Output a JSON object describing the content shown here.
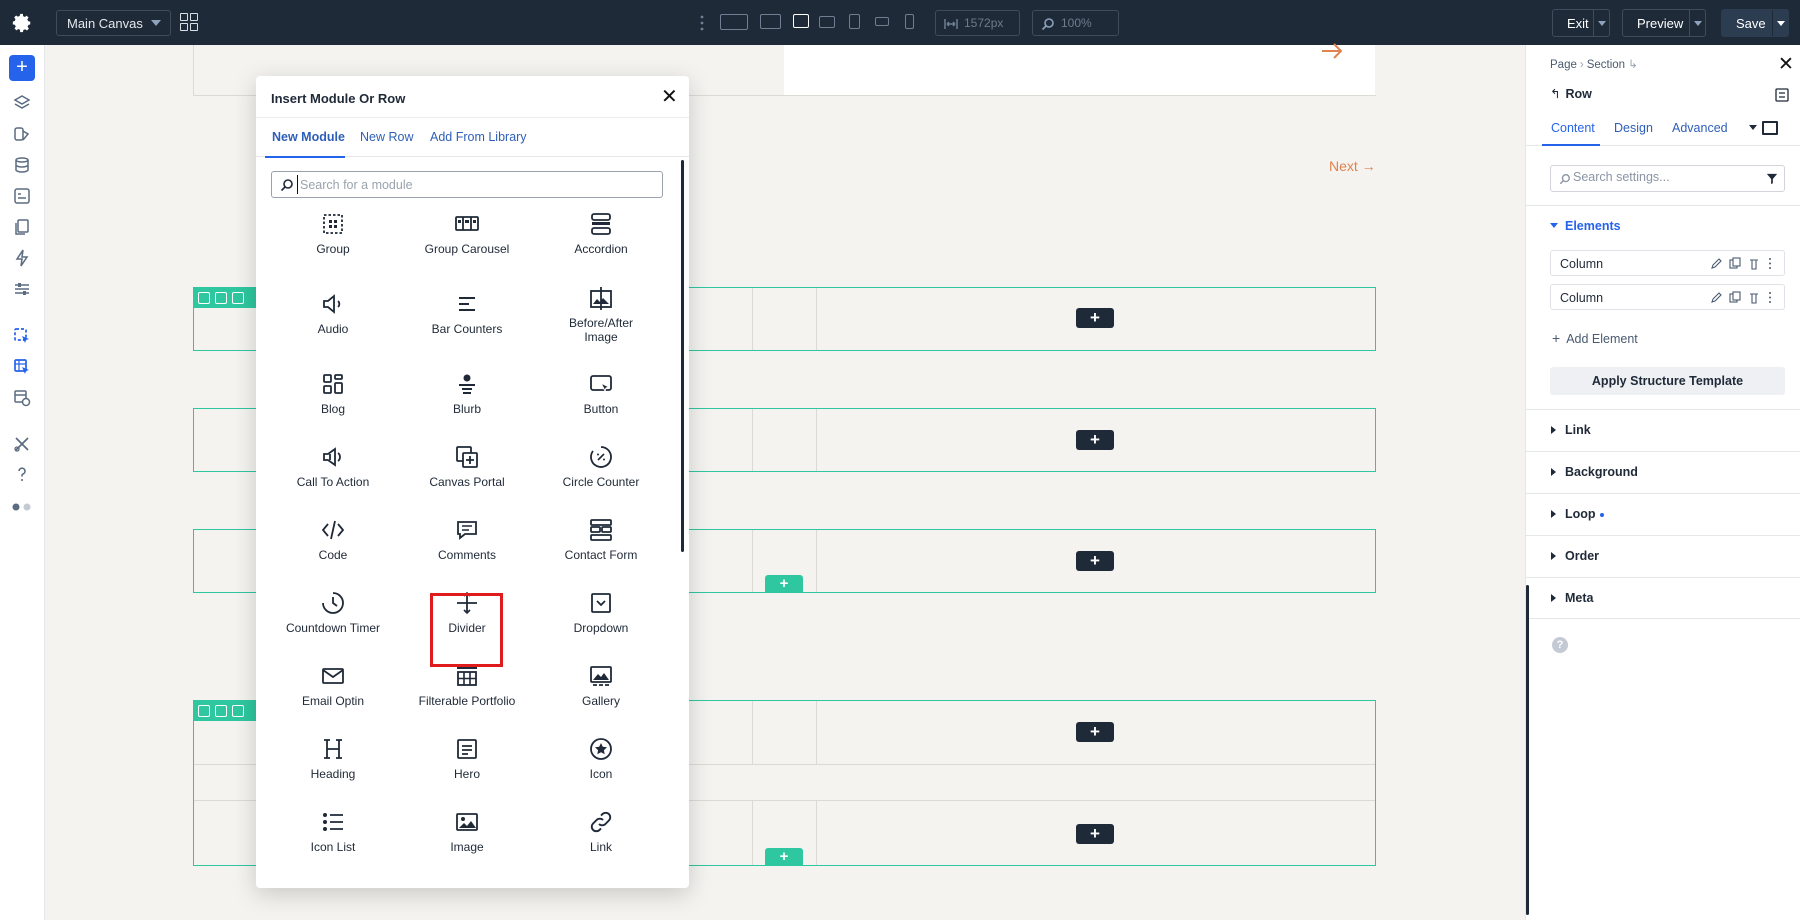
{
  "toolbar": {
    "canvas_select": "Main Canvas",
    "width_value": "1572px",
    "zoom_value": "100%",
    "exit_label": "Exit",
    "preview_label": "Preview",
    "save_label": "Save"
  },
  "canvas": {
    "next_label": "Next →"
  },
  "modal": {
    "title": "Insert Module Or Row",
    "tabs": [
      "New Module",
      "New Row",
      "Add From Library"
    ],
    "search_placeholder": "Search for a module",
    "modules": [
      {
        "label": "Group",
        "icon": "group-icon"
      },
      {
        "label": "Group Carousel",
        "icon": "group-carousel-icon"
      },
      {
        "label": "Accordion",
        "icon": "accordion-icon"
      },
      {
        "label": "Audio",
        "icon": "audio-icon"
      },
      {
        "label": "Bar Counters",
        "icon": "bar-counters-icon"
      },
      {
        "label": "Before/After Image",
        "icon": "before-after-image-icon"
      },
      {
        "label": "Blog",
        "icon": "blog-icon"
      },
      {
        "label": "Blurb",
        "icon": "blurb-icon"
      },
      {
        "label": "Button",
        "icon": "button-icon"
      },
      {
        "label": "Call To Action",
        "icon": "call-to-action-icon"
      },
      {
        "label": "Canvas Portal",
        "icon": "canvas-portal-icon"
      },
      {
        "label": "Circle Counter",
        "icon": "circle-counter-icon"
      },
      {
        "label": "Code",
        "icon": "code-icon"
      },
      {
        "label": "Comments",
        "icon": "comments-icon"
      },
      {
        "label": "Contact Form",
        "icon": "contact-form-icon"
      },
      {
        "label": "Countdown Timer",
        "icon": "countdown-timer-icon"
      },
      {
        "label": "Divider",
        "icon": "divider-icon"
      },
      {
        "label": "Dropdown",
        "icon": "dropdown-icon"
      },
      {
        "label": "Email Optin",
        "icon": "email-optin-icon"
      },
      {
        "label": "Filterable Portfolio",
        "icon": "filterable-portfolio-icon"
      },
      {
        "label": "Gallery",
        "icon": "gallery-icon"
      },
      {
        "label": "Heading",
        "icon": "heading-icon"
      },
      {
        "label": "Hero",
        "icon": "hero-icon"
      },
      {
        "label": "Icon",
        "icon": "icon-module-icon"
      },
      {
        "label": "Icon List",
        "icon": "icon-list-icon"
      },
      {
        "label": "Image",
        "icon": "image-icon"
      },
      {
        "label": "Link",
        "icon": "link-icon"
      }
    ]
  },
  "panel": {
    "breadcrumb": [
      "Page",
      "Section"
    ],
    "title": "Row",
    "tabs": [
      "Content",
      "Design",
      "Advanced"
    ],
    "search_placeholder": "Search settings...",
    "elements_label": "Elements",
    "elements": [
      "Column",
      "Column"
    ],
    "add_element_label": "Add Element",
    "apply_template_label": "Apply Structure Template",
    "sections": [
      "Link",
      "Background",
      "Loop",
      "Order",
      "Meta"
    ]
  },
  "colors": {
    "topbar": "#1e2a38",
    "accent_blue": "#2563eb",
    "row_outline": "#2fc7a0",
    "link_orange": "#e0834f",
    "highlight_red": "#e01b1b"
  }
}
